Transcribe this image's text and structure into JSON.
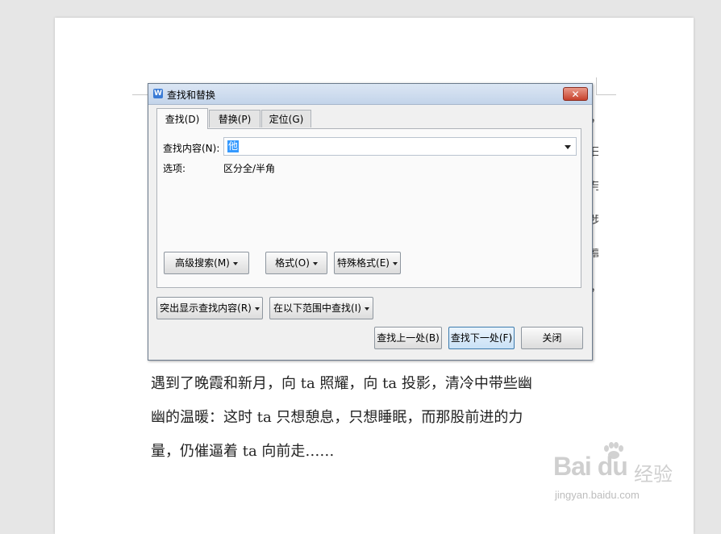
{
  "dialog": {
    "title": "查找和替换",
    "close_symbol": "✕",
    "tabs": [
      {
        "label": "查找(D)",
        "active": true
      },
      {
        "label": "替换(P)",
        "active": false
      },
      {
        "label": "定位(G)",
        "active": false
      }
    ],
    "find_label": "查找内容(N):",
    "find_value": "他",
    "options_label": "选项:",
    "options_value": "区分全/半角",
    "buttons": {
      "advanced": "高级搜索(M)",
      "format": "格式(O)",
      "special": "特殊格式(E)",
      "highlight": "突出显示查找内容(R)",
      "scope": "在以下范围中查找(I)",
      "prev": "查找上一处(B)",
      "next": "查找下一处(F)",
      "close": "关闭"
    }
  },
  "document": {
    "lines": [
      "遇到了晚霞和新月，向 ta 照耀，向 ta 投影，清冷中带些幽",
      "幽的温暖：这时 ta 只想憩息，只想睡眠，而那股前进的力",
      "量，仍催逼着 ta 向前走……"
    ],
    "right_fragments": [
      "，",
      "日",
      "与",
      "步",
      "高",
      "，"
    ]
  },
  "watermark": {
    "brand": "Bai du",
    "brand_cn": "经验",
    "site": "jingyan.baidu.com"
  },
  "colors": {
    "accent": "#3399ff",
    "titlebar": "#c3d4ea",
    "close": "#c7412c"
  }
}
